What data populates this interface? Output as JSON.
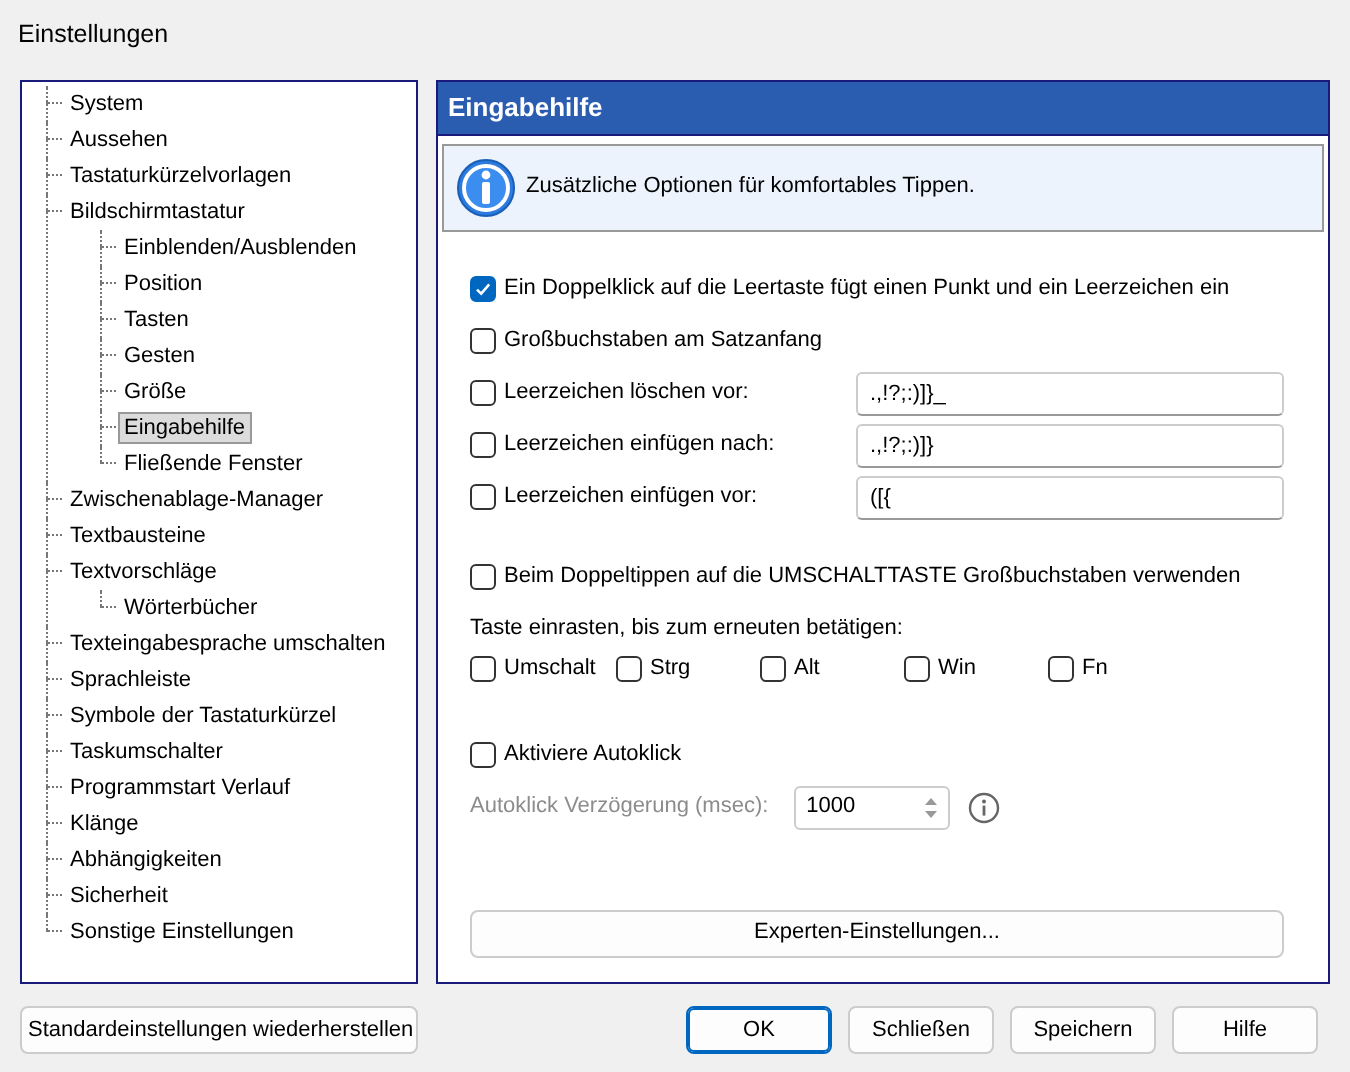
{
  "window": {
    "title": "Einstellungen"
  },
  "tree": {
    "items": [
      {
        "label": "System",
        "selected": false
      },
      {
        "label": "Aussehen",
        "selected": false
      },
      {
        "label": "Tastaturkürzelvorlagen",
        "selected": false
      },
      {
        "label": "Bildschirmtastatur",
        "selected": false,
        "children": [
          {
            "label": "Einblenden/Ausblenden",
            "selected": false
          },
          {
            "label": "Position",
            "selected": false
          },
          {
            "label": "Tasten",
            "selected": false
          },
          {
            "label": "Gesten",
            "selected": false
          },
          {
            "label": "Größe",
            "selected": false
          },
          {
            "label": "Eingabehilfe",
            "selected": true
          },
          {
            "label": "Fließende Fenster",
            "selected": false
          }
        ]
      },
      {
        "label": "Zwischenablage-Manager",
        "selected": false
      },
      {
        "label": "Textbausteine",
        "selected": false
      },
      {
        "label": "Textvorschläge",
        "selected": false,
        "children": [
          {
            "label": "Wörterbücher",
            "selected": false
          }
        ]
      },
      {
        "label": "Texteingabesprache umschalten",
        "selected": false
      },
      {
        "label": "Sprachleiste",
        "selected": false
      },
      {
        "label": "Symbole der Tastaturkürzel",
        "selected": false
      },
      {
        "label": "Taskumschalter",
        "selected": false
      },
      {
        "label": "Programmstart Verlauf",
        "selected": false
      },
      {
        "label": "Klänge",
        "selected": false
      },
      {
        "label": "Abhängigkeiten",
        "selected": false
      },
      {
        "label": "Sicherheit",
        "selected": false
      },
      {
        "label": "Sonstige Einstellungen",
        "selected": false
      }
    ]
  },
  "panel": {
    "title": "Eingabehilfe",
    "info": "Zusätzliche Optionen für komfortables Tippen.",
    "options": [
      {
        "kind": "checkbox",
        "label": "Ein Doppelklick auf die Leertaste fügt einen Punkt und ein Leerzeichen ein",
        "checked": true
      },
      {
        "kind": "checkbox",
        "label": "Großbuchstaben am Satzanfang",
        "checked": false
      },
      {
        "kind": "field",
        "label": "Leerzeichen löschen vor:",
        "checked": false,
        "value": ".,!?;:)]}_"
      },
      {
        "kind": "field",
        "label": "Leerzeichen einfügen nach:",
        "checked": false,
        "value": ".,!?;:)]}"
      },
      {
        "kind": "field",
        "label": "Leerzeichen einfügen vor:",
        "checked": false,
        "value": "([{"
      },
      {
        "kind": "gap"
      },
      {
        "kind": "checkbox",
        "label": "Beim Doppeltippen auf die UMSCHALTTASTE Großbuchstaben verwenden",
        "checked": false
      }
    ],
    "sticky_label": "Taste einrasten, bis zum erneuten betätigen:",
    "sticky_keys": [
      {
        "label": "Umschalt",
        "checked": false
      },
      {
        "label": "Strg",
        "checked": false
      },
      {
        "label": "Alt",
        "checked": false
      },
      {
        "label": "Win",
        "checked": false
      },
      {
        "label": "Fn",
        "checked": false
      }
    ],
    "autoclick": {
      "label": "Aktiviere Autoklick",
      "checked": false
    },
    "autoclick_delay": {
      "label": "Autoklick Verzögerung (msec):",
      "value": "1000",
      "disabled": true
    },
    "expert_button": "Experten-Einstellungen..."
  },
  "footer": {
    "restore_button": "Standardeinstellungen wiederherstellen",
    "buttons": [
      {
        "label": "OK",
        "default": true
      },
      {
        "label": "Schließen",
        "default": false
      },
      {
        "label": "Speichern",
        "default": false
      },
      {
        "label": "Hilfe",
        "default": false
      }
    ]
  }
}
